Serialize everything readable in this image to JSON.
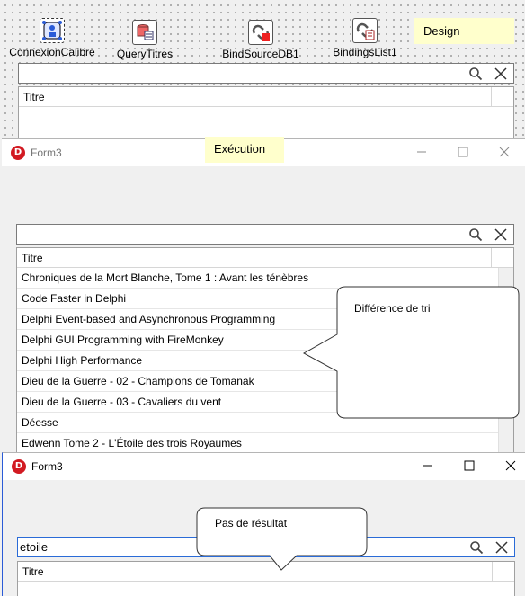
{
  "design": {
    "components": [
      {
        "name": "ConnexionCalibre"
      },
      {
        "name": "QueryTitres"
      },
      {
        "name": "BindSourceDB1"
      },
      {
        "name": "BindingsList1"
      }
    ],
    "note": "Design",
    "search_value": "",
    "list_header": "Titre"
  },
  "exec_note": "Exécution",
  "form_top": {
    "title": "Form3",
    "search_value": "",
    "list_header": "Titre",
    "rows": [
      "Chroniques de la Mort Blanche, Tome 1 : Avant les ténèbres",
      "Code Faster in Delphi",
      "Delphi Event-based and Asynchronous Programming",
      "Delphi GUI Programming with FireMonkey",
      "Delphi High Performance",
      "Dieu de la Guerre - 02 - Champions de Tomanak",
      "Dieu de la Guerre - 03 - Cavaliers du vent",
      "Déesse",
      "Edwenn Tome 2 - L'Étoile des trois Royaumes"
    ]
  },
  "callout_sort": "Différence de tri",
  "form_bottom": {
    "title": "Form3",
    "search_value": "etoile",
    "list_header": "Titre"
  },
  "callout_noresult": "Pas de résultat",
  "colors": {
    "note_bg": "#ffffcc",
    "delphi_red": "#d21a22"
  }
}
